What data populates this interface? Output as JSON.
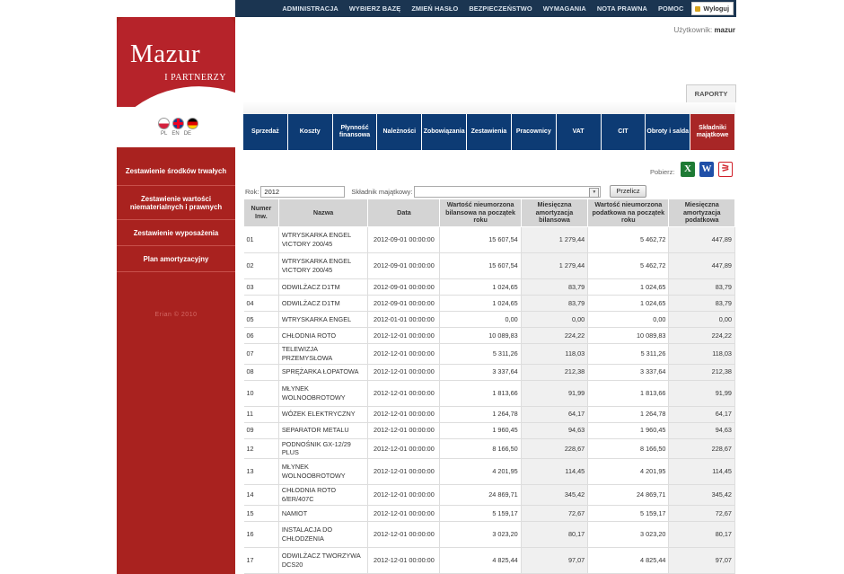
{
  "topnav": {
    "items": [
      "ADMINISTRACJA",
      "WYBIERZ BAZĘ",
      "ZMIEŃ HASŁO",
      "BEZPIECZEŃSTWO",
      "WYMAGANIA",
      "NOTA PRAWNA",
      "POMOC"
    ],
    "logout_label": "Wyloguj"
  },
  "logo": {
    "name": "Mazur",
    "sub": "I PARTNERZY"
  },
  "languages": [
    "PL",
    "EN",
    "DE"
  ],
  "user": {
    "label": "Użytkownik:",
    "name": "mazur"
  },
  "sidebar": {
    "items": [
      {
        "label": "Zestawienie środków trwałych"
      },
      {
        "label": "Zestawienie wartości niematerialnych i prawnych"
      },
      {
        "label": "Zestawienie wyposażenia"
      },
      {
        "label": "Plan amortyzacyjny"
      }
    ],
    "footer": "Erian © 2010"
  },
  "tabs": {
    "raporty": "RAPORTY"
  },
  "categories": [
    {
      "label": "Sprzedaż"
    },
    {
      "label": "Koszty"
    },
    {
      "label": "Płynność finansowa"
    },
    {
      "label": "Należności"
    },
    {
      "label": "Zobowiązania"
    },
    {
      "label": "Zestawienia"
    },
    {
      "label": "Pracownicy"
    },
    {
      "label": "VAT"
    },
    {
      "label": "CIT"
    },
    {
      "label": "Obroty i salda"
    },
    {
      "label": "Składniki majątkowe"
    }
  ],
  "export": {
    "label": "Pobierz:",
    "icons": [
      "excel-icon",
      "word-icon",
      "pdf-icon"
    ]
  },
  "filter": {
    "year_label": "Rok:",
    "year_value": "2012",
    "asset_label": "Składnik majątkowy:",
    "asset_value": "",
    "button": "Przelicz"
  },
  "table": {
    "headers": [
      "Numer Inw.",
      "Nazwa",
      "Data",
      "Wartość nieumorzona bilansowa na początek roku",
      "Miesięczna amortyzacja bilansowa",
      "Wartość nieumorzona podatkowa na początek roku",
      "Miesięczna amortyzacja podatkowa"
    ],
    "rows": [
      [
        "01",
        "WTRYSKARKA ENGEL VICTORY 200/45",
        "2012-09-01 00:00:00",
        "15 607,54",
        "1 279,44",
        "5 462,72",
        "447,89"
      ],
      [
        "02",
        "WTRYSKARKA ENGEL VICTORY 200/45",
        "2012-09-01 00:00:00",
        "15 607,54",
        "1 279,44",
        "5 462,72",
        "447,89"
      ],
      [
        "03",
        "ODWILŻACZ D1TM",
        "2012-09-01 00:00:00",
        "1 024,65",
        "83,79",
        "1 024,65",
        "83,79"
      ],
      [
        "04",
        "ODWILŻACZ D1TM",
        "2012-09-01 00:00:00",
        "1 024,65",
        "83,79",
        "1 024,65",
        "83,79"
      ],
      [
        "05",
        "WTRYSKARKA ENGEL",
        "2012-01-01 00:00:00",
        "0,00",
        "0,00",
        "0,00",
        "0,00"
      ],
      [
        "06",
        "CHŁODNIA ROTO",
        "2012-12-01 00:00:00",
        "10 089,83",
        "224,22",
        "10 089,83",
        "224,22"
      ],
      [
        "07",
        "TELEWIZJA PRZEMYSŁOWA",
        "2012-12-01 00:00:00",
        "5 311,26",
        "118,03",
        "5 311,26",
        "118,03"
      ],
      [
        "08",
        "SPRĘŻARKA ŁOPATOWA",
        "2012-12-01 00:00:00",
        "3 337,64",
        "212,38",
        "3 337,64",
        "212,38"
      ],
      [
        "10",
        "MŁYNEK WOLNOOBROTOWY",
        "2012-12-01 00:00:00",
        "1 813,66",
        "91,99",
        "1 813,66",
        "91,99"
      ],
      [
        "11",
        "WÓZEK ELEKTRYCZNY",
        "2012-12-01 00:00:00",
        "1 264,78",
        "64,17",
        "1 264,78",
        "64,17"
      ],
      [
        "09",
        "SEPARATOR METALU",
        "2012-12-01 00:00:00",
        "1 960,45",
        "94,63",
        "1 960,45",
        "94,63"
      ],
      [
        "12",
        "PODNOŚNIK GX-12/29 PLUS",
        "2012-12-01 00:00:00",
        "8 166,50",
        "228,67",
        "8 166,50",
        "228,67"
      ],
      [
        "13",
        "MŁYNEK WOLNOOBROTOWY",
        "2012-12-01 00:00:00",
        "4 201,95",
        "114,45",
        "4 201,95",
        "114,45"
      ],
      [
        "14",
        "CHŁODNIA ROTO 6/ER/407C",
        "2012-12-01 00:00:00",
        "24 869,71",
        "345,42",
        "24 869,71",
        "345,42"
      ],
      [
        "15",
        "NAMIOT",
        "2012-12-01 00:00:00",
        "5 159,17",
        "72,67",
        "5 159,17",
        "72,67"
      ],
      [
        "16",
        "INSTALACJA DO CHŁODZENIA",
        "2012-12-01 00:00:00",
        "3 023,20",
        "80,17",
        "3 023,20",
        "80,17"
      ],
      [
        "17",
        "ODWILŻACZ TWORZYWA DCS20",
        "2012-12-01 00:00:00",
        "4 825,44",
        "97,07",
        "4 825,44",
        "97,07"
      ]
    ]
  }
}
